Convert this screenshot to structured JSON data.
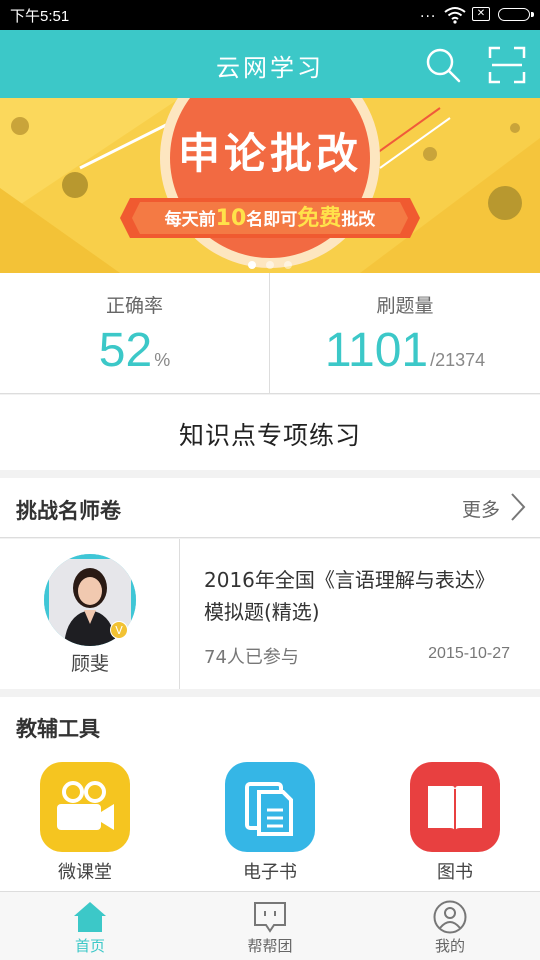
{
  "status_bar": {
    "time": "下午5:51",
    "dots": "...",
    "sim": "✕"
  },
  "header": {
    "title": "云网学习"
  },
  "banner": {
    "title": "申论批改",
    "subtitle_pre": "每天前",
    "subtitle_num": "10",
    "subtitle_mid": "名即可",
    "subtitle_free": "免费",
    "subtitle_post": "批改",
    "page_count": 3,
    "active_index": 0
  },
  "stats": {
    "accuracy": {
      "label": "正确率",
      "value": "52",
      "unit": "%"
    },
    "questions": {
      "label": "刷题量",
      "value": "1101",
      "total": "/21374"
    }
  },
  "practice": {
    "label": "知识点专项练习"
  },
  "challenge": {
    "heading": "挑战名师卷",
    "more": "更多",
    "teacher_name": "顾斐",
    "badge": "V",
    "paper_title": "2016年全国《言语理解与表达》模拟题(精选)",
    "participants": "74人已参与",
    "date": "2015-10-27"
  },
  "tools": {
    "heading": "教辅工具",
    "items": [
      {
        "label": "微课堂",
        "color": "#f5c520"
      },
      {
        "label": "电子书",
        "color": "#35b6e6"
      },
      {
        "label": "图书",
        "color": "#e84040"
      }
    ]
  },
  "nav": {
    "items": [
      {
        "label": "首页",
        "active": true
      },
      {
        "label": "帮帮团",
        "active": false
      },
      {
        "label": "我的",
        "active": false
      }
    ]
  },
  "colors": {
    "accent": "#3cc8c8",
    "banner_bg": "#f8cf4a",
    "banner_circle": "#f26a42"
  }
}
